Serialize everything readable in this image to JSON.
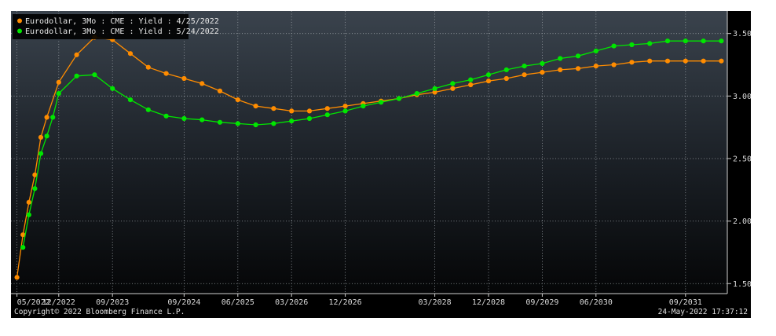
{
  "chart_data": {
    "type": "line",
    "series": [
      {
        "name": "Eurodollar, 3Mo : CME : Yield : 4/25/2022",
        "color": "#ff8c00",
        "points": [
          {
            "x": "2022-05",
            "y": 1.55
          },
          {
            "x": "2022-06",
            "y": 1.89
          },
          {
            "x": "2022-07",
            "y": 2.15
          },
          {
            "x": "2022-08",
            "y": 2.37
          },
          {
            "x": "2022-09",
            "y": 2.67
          },
          {
            "x": "2022-10",
            "y": 2.83
          },
          {
            "x": "2022-12",
            "y": 3.11
          },
          {
            "x": "2023-03",
            "y": 3.33
          },
          {
            "x": "2023-06",
            "y": 3.47
          },
          {
            "x": "2023-09",
            "y": 3.45
          },
          {
            "x": "2023-12",
            "y": 3.34
          },
          {
            "x": "2024-03",
            "y": 3.23
          },
          {
            "x": "2024-06",
            "y": 3.18
          },
          {
            "x": "2024-09",
            "y": 3.14
          },
          {
            "x": "2024-12",
            "y": 3.1
          },
          {
            "x": "2025-03",
            "y": 3.04
          },
          {
            "x": "2025-06",
            "y": 2.97
          },
          {
            "x": "2025-09",
            "y": 2.92
          },
          {
            "x": "2025-12",
            "y": 2.9
          },
          {
            "x": "2026-03",
            "y": 2.88
          },
          {
            "x": "2026-06",
            "y": 2.88
          },
          {
            "x": "2026-09",
            "y": 2.9
          },
          {
            "x": "2026-12",
            "y": 2.92
          },
          {
            "x": "2027-03",
            "y": 2.94
          },
          {
            "x": "2027-06",
            "y": 2.96
          },
          {
            "x": "2027-09",
            "y": 2.98
          },
          {
            "x": "2027-12",
            "y": 3.01
          },
          {
            "x": "2028-03",
            "y": 3.03
          },
          {
            "x": "2028-06",
            "y": 3.06
          },
          {
            "x": "2028-09",
            "y": 3.09
          },
          {
            "x": "2028-12",
            "y": 3.12
          },
          {
            "x": "2029-03",
            "y": 3.14
          },
          {
            "x": "2029-06",
            "y": 3.17
          },
          {
            "x": "2029-09",
            "y": 3.19
          },
          {
            "x": "2029-12",
            "y": 3.21
          },
          {
            "x": "2030-03",
            "y": 3.22
          },
          {
            "x": "2030-06",
            "y": 3.24
          },
          {
            "x": "2030-09",
            "y": 3.25
          },
          {
            "x": "2030-12",
            "y": 3.27
          },
          {
            "x": "2031-03",
            "y": 3.28
          },
          {
            "x": "2031-06",
            "y": 3.28
          },
          {
            "x": "2031-09",
            "y": 3.28
          },
          {
            "x": "2031-12",
            "y": 3.28
          },
          {
            "x": "2032-03",
            "y": 3.28
          }
        ]
      },
      {
        "name": "Eurodollar, 3Mo : CME : Yield : 5/24/2022",
        "color": "#00e600",
        "points": [
          {
            "x": "2022-06",
            "y": 1.79
          },
          {
            "x": "2022-07",
            "y": 2.05
          },
          {
            "x": "2022-08",
            "y": 2.26
          },
          {
            "x": "2022-09",
            "y": 2.54
          },
          {
            "x": "2022-10",
            "y": 2.68
          },
          {
            "x": "2022-11",
            "y": 2.83
          },
          {
            "x": "2022-12",
            "y": 3.02
          },
          {
            "x": "2023-03",
            "y": 3.16
          },
          {
            "x": "2023-06",
            "y": 3.17
          },
          {
            "x": "2023-09",
            "y": 3.06
          },
          {
            "x": "2023-12",
            "y": 2.97
          },
          {
            "x": "2024-03",
            "y": 2.89
          },
          {
            "x": "2024-06",
            "y": 2.84
          },
          {
            "x": "2024-09",
            "y": 2.82
          },
          {
            "x": "2024-12",
            "y": 2.81
          },
          {
            "x": "2025-03",
            "y": 2.79
          },
          {
            "x": "2025-06",
            "y": 2.78
          },
          {
            "x": "2025-09",
            "y": 2.77
          },
          {
            "x": "2025-12",
            "y": 2.78
          },
          {
            "x": "2026-03",
            "y": 2.8
          },
          {
            "x": "2026-06",
            "y": 2.82
          },
          {
            "x": "2026-09",
            "y": 2.85
          },
          {
            "x": "2026-12",
            "y": 2.88
          },
          {
            "x": "2027-03",
            "y": 2.92
          },
          {
            "x": "2027-06",
            "y": 2.95
          },
          {
            "x": "2027-09",
            "y": 2.98
          },
          {
            "x": "2027-12",
            "y": 3.02
          },
          {
            "x": "2028-03",
            "y": 3.06
          },
          {
            "x": "2028-06",
            "y": 3.1
          },
          {
            "x": "2028-09",
            "y": 3.13
          },
          {
            "x": "2028-12",
            "y": 3.17
          },
          {
            "x": "2029-03",
            "y": 3.21
          },
          {
            "x": "2029-06",
            "y": 3.24
          },
          {
            "x": "2029-09",
            "y": 3.26
          },
          {
            "x": "2029-12",
            "y": 3.3
          },
          {
            "x": "2030-03",
            "y": 3.32
          },
          {
            "x": "2030-06",
            "y": 3.36
          },
          {
            "x": "2030-09",
            "y": 3.4
          },
          {
            "x": "2030-12",
            "y": 3.41
          },
          {
            "x": "2031-03",
            "y": 3.42
          },
          {
            "x": "2031-06",
            "y": 3.44
          },
          {
            "x": "2031-09",
            "y": 3.44
          },
          {
            "x": "2031-12",
            "y": 3.44
          },
          {
            "x": "2032-03",
            "y": 3.44
          }
        ]
      }
    ],
    "x_ticks": [
      "05/2022",
      "12/2022",
      "09/2023",
      "09/2024",
      "06/2025",
      "03/2026",
      "12/2026",
      "03/2028",
      "12/2028",
      "09/2029",
      "06/2030",
      "09/2031"
    ],
    "y_ticks": [
      "1.50",
      "2.00",
      "2.50",
      "3.00",
      "3.50"
    ],
    "ylim": [
      1.42,
      3.68
    ],
    "xlim": [
      "2022-04",
      "2032-04"
    ],
    "grid": true,
    "legend_position": "top-left",
    "background": "#000000"
  },
  "footer": {
    "copyright": "Copyright© 2022 Bloomberg Finance L.P.",
    "timestamp": "24-May-2022 17:37:12"
  }
}
